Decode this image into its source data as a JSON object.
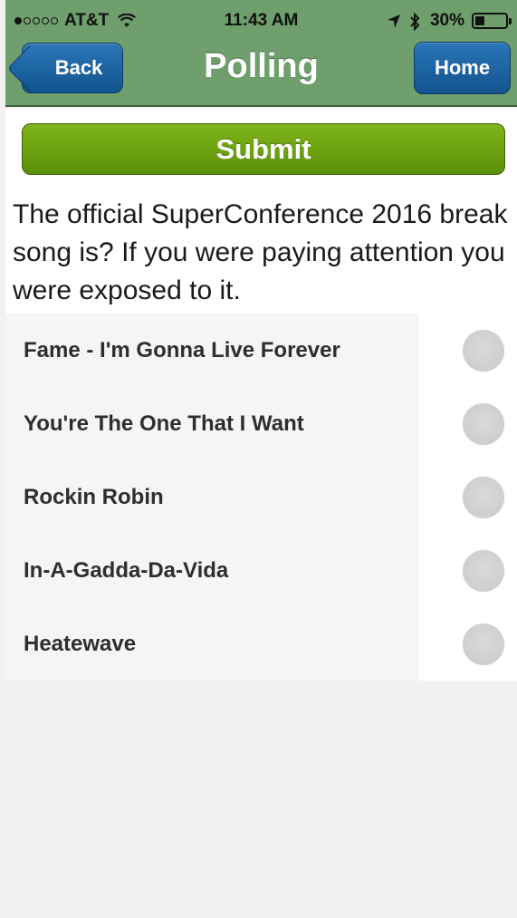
{
  "status": {
    "carrier": "AT&T",
    "time": "11:43 AM",
    "battery": "30%",
    "battery_level": 0.3,
    "signal_bars_filled": 1,
    "signal_bars_total": 5
  },
  "nav": {
    "title": "Polling",
    "back_label": "Back",
    "home_label": "Home"
  },
  "poll": {
    "submit_label": "Submit",
    "question": "The official SuperConference 2016 break song is? If you were paying attention you were exposed to it.",
    "options": [
      {
        "label": "Fame - I'm Gonna Live Forever"
      },
      {
        "label": "You're The One That I Want"
      },
      {
        "label": "Rockin Robin"
      },
      {
        "label": "In-A-Gadda-Da-Vida"
      },
      {
        "label": "Heatewave"
      }
    ]
  },
  "colors": {
    "header_bg": "#6f9f6c",
    "nav_button": "#1a63a3",
    "submit_button": "#6ba312"
  },
  "icons": {
    "wifi": "wifi-icon",
    "location": "location-arrow-icon",
    "bluetooth": "bluetooth-icon",
    "battery": "battery-icon"
  }
}
